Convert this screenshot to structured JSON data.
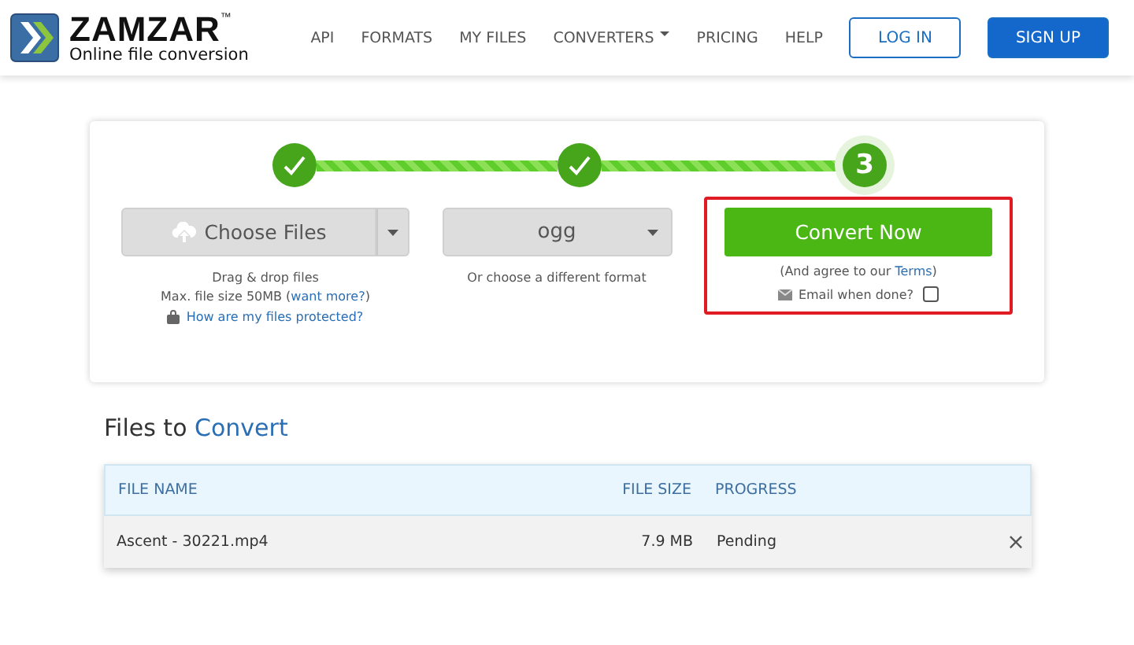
{
  "header": {
    "logo_name": "ZAMZAR",
    "logo_mark": "™",
    "tagline": "Online file conversion",
    "nav": [
      {
        "label": "API",
        "dropdown": false
      },
      {
        "label": "FORMATS",
        "dropdown": false
      },
      {
        "label": "MY FILES",
        "dropdown": false
      },
      {
        "label": "CONVERTERS",
        "dropdown": true
      },
      {
        "label": "PRICING",
        "dropdown": false
      },
      {
        "label": "HELP",
        "dropdown": false
      }
    ],
    "login": "LOG IN",
    "signup": "SIGN UP"
  },
  "steps": [
    {
      "kind": "done"
    },
    {
      "kind": "done",
      "level": 1
    },
    {
      "kind": "current",
      "label": "3",
      "level": 1
    }
  ],
  "choose": {
    "label": "Choose Files",
    "hint": "Drag & drop files",
    "limit": "Max. file size 50MB (",
    "more_link": "want more?",
    "limit_end": ")",
    "protect_link": "How are my files protected?"
  },
  "format": {
    "value": "ogg",
    "hint": "Or choose a different format"
  },
  "convert": {
    "label": "Convert Now",
    "agree_prefix": "(And agree to our ",
    "terms_link": "Terms",
    "agree_suffix": ")",
    "email_label": "Email when done?",
    "email_checked": false,
    "highlighted": true
  },
  "files": {
    "title_part1": "Files to",
    "title_part2": "Convert",
    "columns": [
      "FILE NAME",
      "FILE SIZE",
      "PROGRESS"
    ],
    "rows": [
      {
        "name": "Ascent - 30221.mp4",
        "size": "7.9 MB",
        "progress": "Pending",
        "remove": "×"
      }
    ]
  }
}
